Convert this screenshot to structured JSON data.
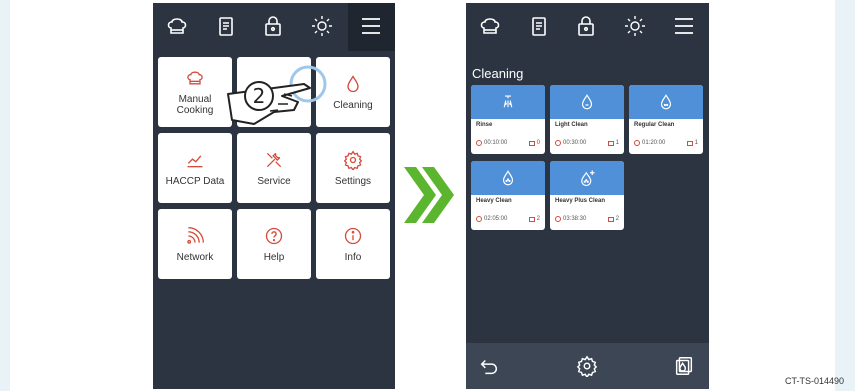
{
  "left_panel": {
    "topbar_icons": [
      "chef-hat-icon",
      "recipe-book-icon",
      "lock-icon",
      "brightness-icon",
      "menu-icon"
    ],
    "tiles": [
      {
        "label": "Manual\nCooking",
        "icon": "chef-hat-icon"
      },
      {
        "label": "",
        "icon": ""
      },
      {
        "label": "Cleaning",
        "icon": "drop-icon"
      },
      {
        "label": "HACCP Data",
        "icon": "chart-icon"
      },
      {
        "label": "Service",
        "icon": "tools-icon"
      },
      {
        "label": "Settings",
        "icon": "gear-icon"
      },
      {
        "label": "Network",
        "icon": "network-icon"
      },
      {
        "label": "Help",
        "icon": "help-icon"
      },
      {
        "label": "Info",
        "icon": "info-icon"
      }
    ],
    "step_marker": "2"
  },
  "right_panel": {
    "title": "Cleaning",
    "programs": [
      {
        "name": "Rinse",
        "duration": "00:10:00",
        "count": "0",
        "icon": "rinse-icon"
      },
      {
        "name": "Light Clean",
        "duration": "00:30:00",
        "count": "1",
        "icon": "drop-icon"
      },
      {
        "name": "Regular Clean",
        "duration": "01:20:00",
        "count": "1",
        "icon": "drop-icon"
      },
      {
        "name": "Heavy Clean",
        "duration": "02:05:00",
        "count": "2",
        "icon": "drop-icon"
      },
      {
        "name": "Heavy Plus Clean",
        "duration": "03:38:30",
        "count": "2",
        "icon": "drop-plus-icon"
      }
    ],
    "bottombar_icons": [
      "back-icon",
      "settings-icon",
      "cleaning-tablet-icon"
    ]
  },
  "doc_code": "CT-TS-014490",
  "colors": {
    "panel": "#2b3440",
    "accent": "#d64c3c",
    "card_head": "#4f90d8",
    "arrow": "#5bb52e"
  }
}
